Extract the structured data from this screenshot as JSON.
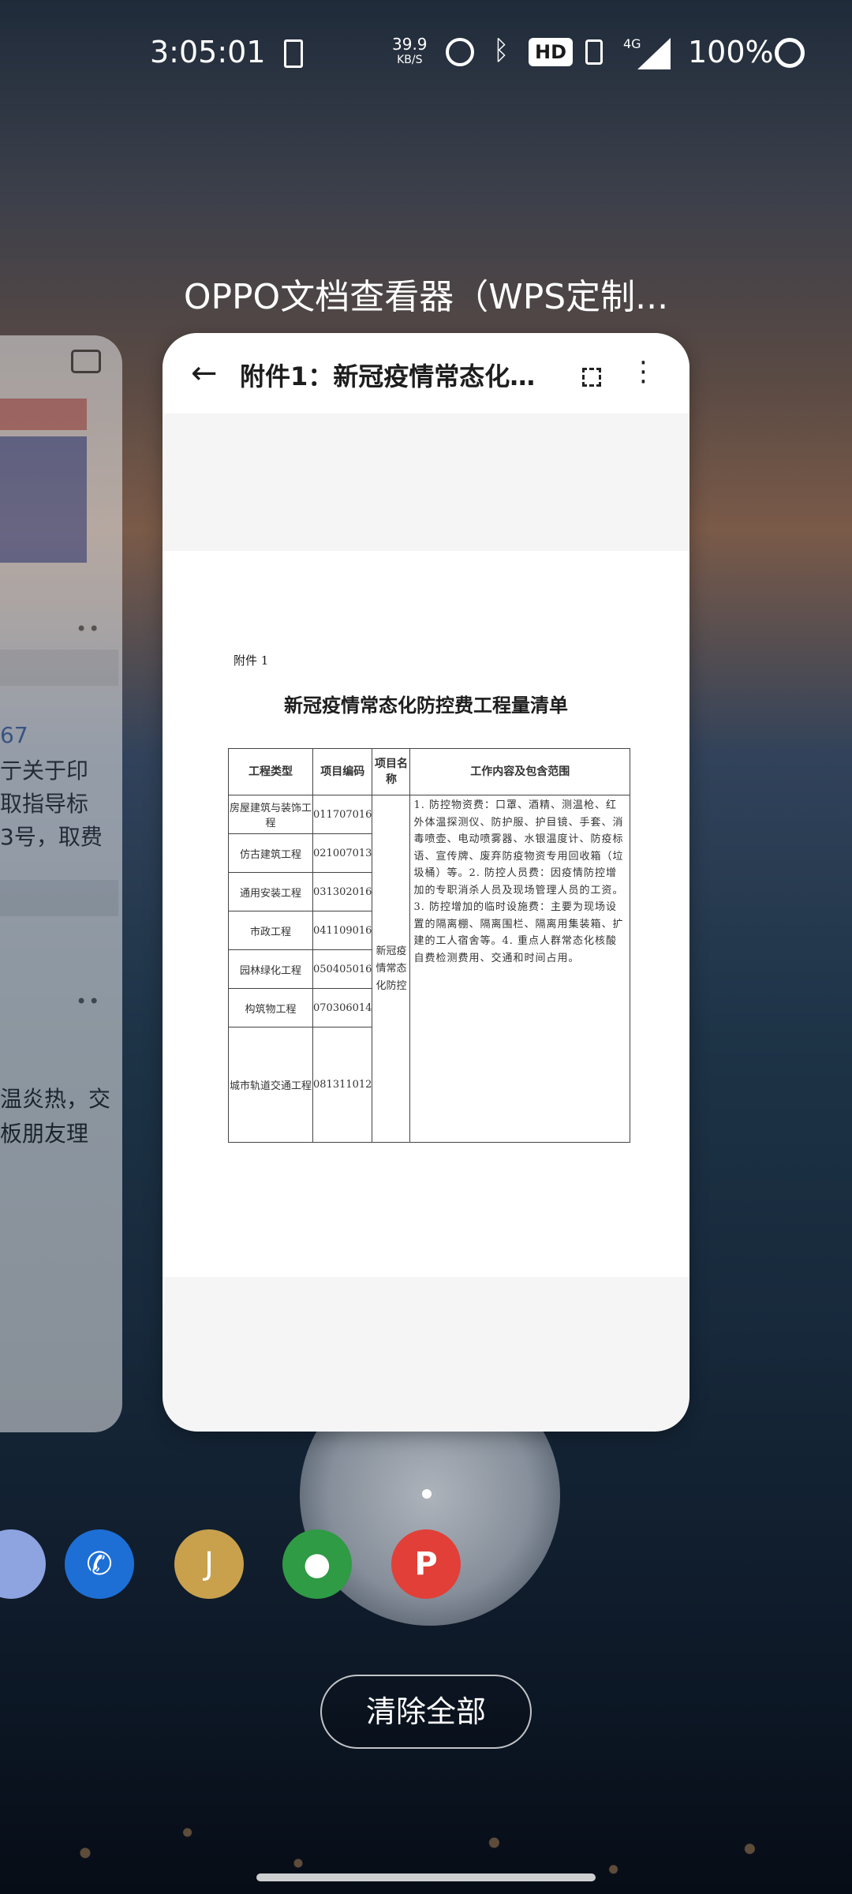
{
  "status_bar": {
    "time": "3:05:01",
    "net_speed": "39.9",
    "net_speed_unit": "KB/S",
    "hd_badge": "HD",
    "network_type": "4G",
    "battery": "100%"
  },
  "background_app": {
    "number": "67",
    "lines": [
      "亍关于印",
      "取指导标",
      "3号，取费",
      "温炎热，交",
      "板朋友理"
    ]
  },
  "app_title": "OPPO文档查看器（WPS定制...",
  "document": {
    "title": "附件1：新冠疫情常态化防控...",
    "label": "附件 1",
    "heading": "新冠疫情常态化防控费工程量清单",
    "columns": [
      "工程类型",
      "项目编码",
      "项目名称",
      "工作内容及包含范围"
    ],
    "rows": [
      {
        "type": "房屋建筑与装饰工程",
        "code": "011707016"
      },
      {
        "type": "仿古建筑工程",
        "code": "021007013"
      },
      {
        "type": "通用安装工程",
        "code": "031302016"
      },
      {
        "type": "市政工程",
        "code": "041109016"
      },
      {
        "type": "园林绿化工程",
        "code": "050405016"
      },
      {
        "type": "构筑物工程",
        "code": "070306014"
      },
      {
        "type": "城市轨道交通工程",
        "code": "081311012"
      }
    ],
    "project_name": "新冠疫情常态化防控",
    "scope": "1. 防控物资费：口罩、酒精、测温枪、红外体温探测仪、防护服、护目镜、手套、消毒喷壶、电动喷雾器、水银温度计、防疫标语、宣传牌、废弃防疫物资专用回收箱（垃圾桶）等。2. 防控人员费：因疫情防控增加的专职消杀人员及现场管理人员的工资。3. 防控增加的临时设施费：主要为现场设置的隔离棚、隔离围栏、隔离用集装箱、扩建的工人宿舍等。4. 重点人群常态化核酸自费检测费用、交通和时间占用。"
  },
  "dock_icons": [
    "app-icon",
    "phone-icon",
    "app-icon-j",
    "wechat-icon",
    "wps-icon"
  ],
  "clear_all": "清除全部"
}
